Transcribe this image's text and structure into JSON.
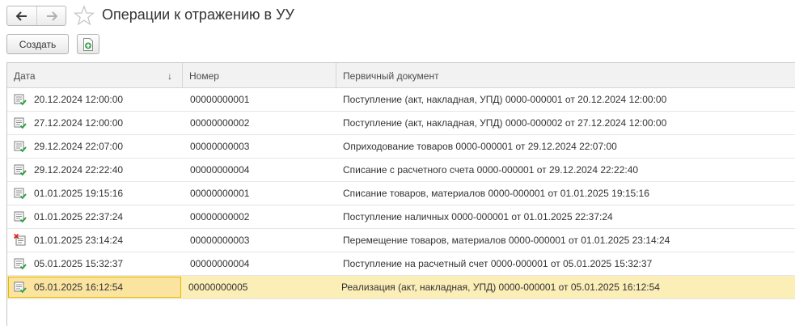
{
  "window": {
    "title": "Операции к отражению в УУ"
  },
  "toolbar": {
    "create_label": "Создать"
  },
  "table": {
    "columns": [
      {
        "label": "Дата",
        "sort": "descending"
      },
      {
        "label": "Номер"
      },
      {
        "label": "Первичный документ"
      }
    ],
    "rows": [
      {
        "date": "20.12.2024 12:00:00",
        "number": "00000000001",
        "document": "Поступление (акт, накладная, УПД) 0000-000001 от 20.12.2024 12:00:00",
        "status": "posted"
      },
      {
        "date": "27.12.2024 12:00:00",
        "number": "00000000002",
        "document": "Поступление (акт, накладная, УПД) 0000-000002 от 27.12.2024 12:00:00",
        "status": "posted"
      },
      {
        "date": "29.12.2024 22:07:00",
        "number": "00000000003",
        "document": "Оприходование товаров 0000-000001 от 29.12.2024 22:07:00",
        "status": "posted"
      },
      {
        "date": "29.12.2024 22:22:40",
        "number": "00000000004",
        "document": "Списание с расчетного счета 0000-000001 от 29.12.2024 22:22:40",
        "status": "posted"
      },
      {
        "date": "01.01.2025 19:15:16",
        "number": "00000000001",
        "document": "Списание товаров, материалов 0000-000001 от 01.01.2025 19:15:16",
        "status": "posted"
      },
      {
        "date": "01.01.2025 22:37:24",
        "number": "00000000002",
        "document": "Поступление наличных 0000-000001 от 01.01.2025 22:37:24",
        "status": "posted"
      },
      {
        "date": "01.01.2025 23:14:24",
        "number": "00000000003",
        "document": "Перемещение товаров, материалов 0000-000001 от 01.01.2025 23:14:24",
        "status": "deleted"
      },
      {
        "date": "05.01.2025 15:32:37",
        "number": "00000000004",
        "document": "Поступление на расчетный счет 0000-000001 от 05.01.2025 15:32:37",
        "status": "posted"
      },
      {
        "date": "05.01.2025 16:12:54",
        "number": "00000000005",
        "document": "Реализация (акт, накладная, УПД) 0000-000001 от 05.01.2025 16:12:54",
        "status": "posted",
        "selected": true
      }
    ]
  },
  "colors": {
    "selected_row": "#fbeeb7",
    "selected_cell_border": "#e6b800",
    "posted_icon": "#2ea043",
    "deleted_icon": "#d9291c"
  }
}
